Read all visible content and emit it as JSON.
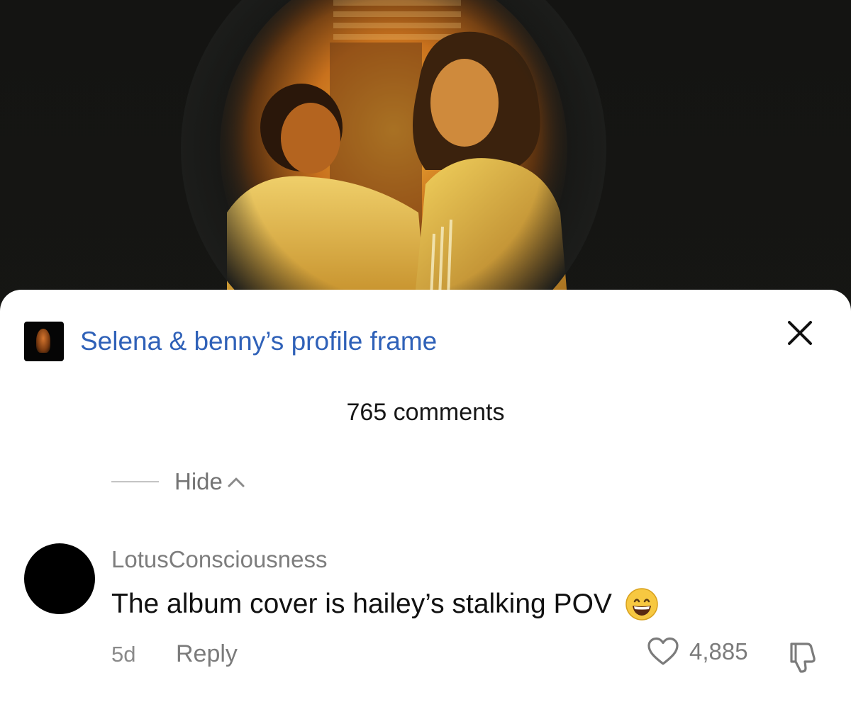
{
  "video": {
    "description_icon": "video-still"
  },
  "sheet": {
    "frame_title": "Selena & benny’s profile frame",
    "close_icon": "close-icon",
    "comment_count": "765 comments",
    "hide_label": "Hide",
    "colors": {
      "link": "#2f61b8",
      "muted": "#7b7b7b",
      "text": "#111111"
    }
  },
  "comment": {
    "username": "LotusConsciousness",
    "text": "The album cover is hailey’s stalking POV",
    "emoji": "grinning-face-emoji",
    "time": "5d",
    "reply_label": "Reply",
    "likes": "4,885"
  }
}
